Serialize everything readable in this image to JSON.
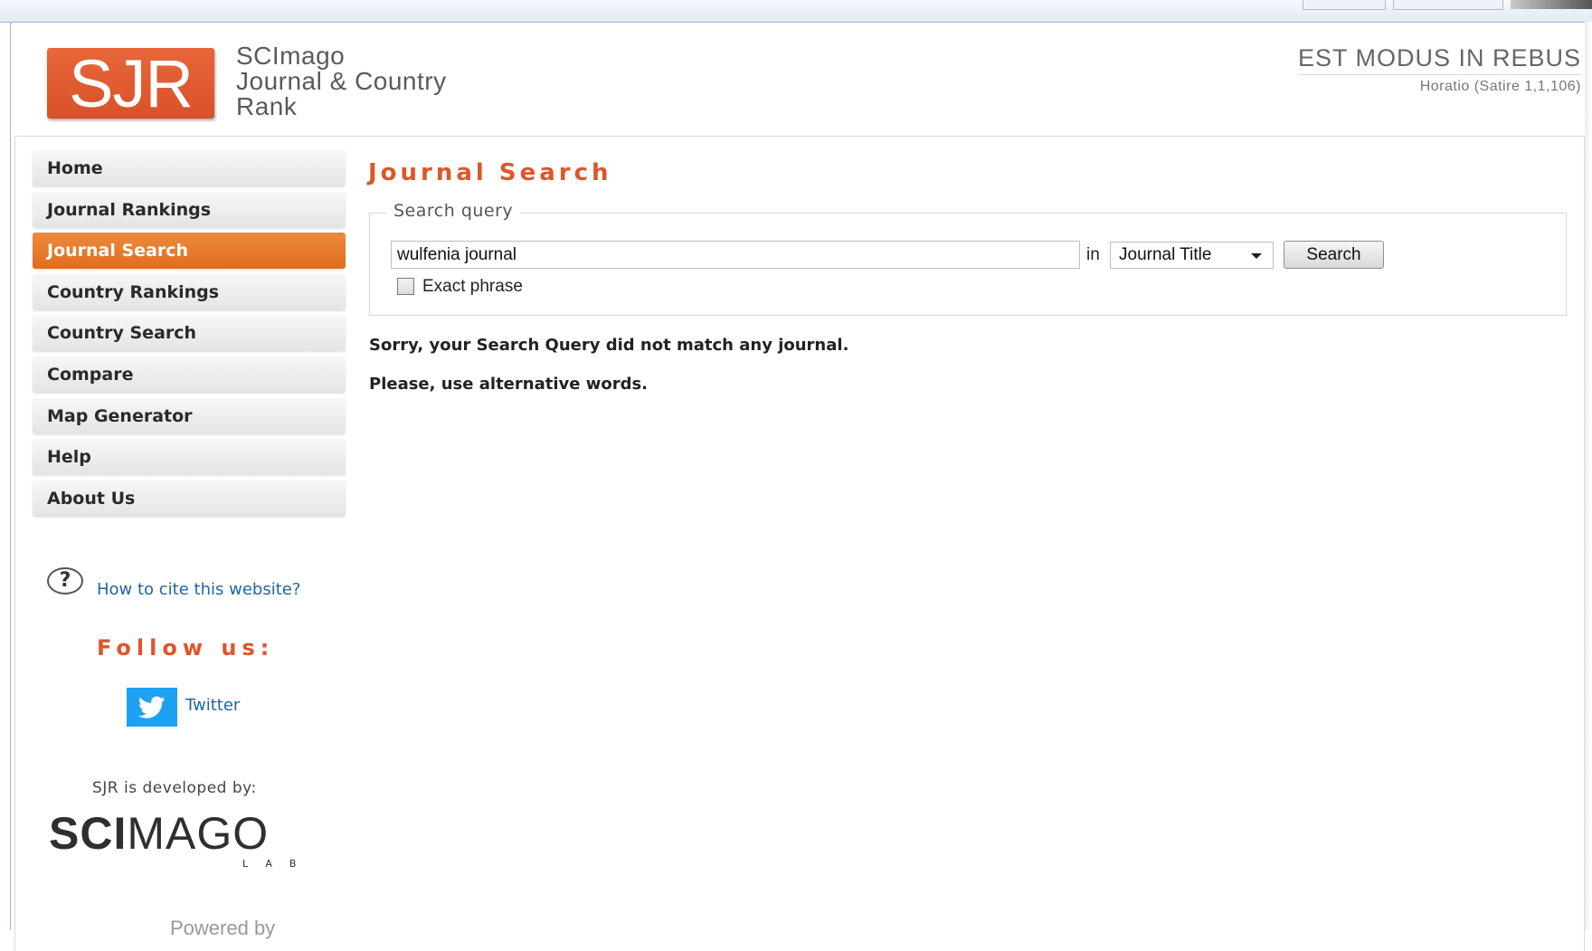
{
  "header": {
    "logo_text": "SJR",
    "site_title_lines": [
      "SCImago",
      "Journal & Country",
      "Rank"
    ],
    "motto": "EST MODUS IN REBUS",
    "motto_source": "Horatio (Satire 1,1,106)"
  },
  "sidebar": {
    "items": [
      {
        "label": "Home",
        "active": false
      },
      {
        "label": "Journal Rankings",
        "active": false
      },
      {
        "label": "Journal Search",
        "active": true
      },
      {
        "label": "Country Rankings",
        "active": false
      },
      {
        "label": "Country Search",
        "active": false
      },
      {
        "label": "Compare",
        "active": false
      },
      {
        "label": "Map Generator",
        "active": false
      },
      {
        "label": "Help",
        "active": false
      },
      {
        "label": "About Us",
        "active": false
      }
    ],
    "cite_icon": "question-circle-icon",
    "cite_link": "How to cite this website?",
    "follow_heading": "Follow us:",
    "twitter_icon": "twitter-icon",
    "twitter_label": "Twitter",
    "developed_by": "SJR is developed by:",
    "developer_logo": {
      "main_bold": "SCI",
      "main_light": "MAGO",
      "sub": "LAB"
    },
    "powered_by": "Powered by"
  },
  "main": {
    "title": "Journal Search",
    "fieldset_legend": "Search query",
    "search_value": "wulfenia journal",
    "in_label": "in",
    "search_field_selected": "Journal Title",
    "search_button": "Search",
    "exact_phrase_label": "Exact phrase",
    "exact_phrase_checked": false,
    "message_1": "Sorry, your Search Query did not match any journal.",
    "message_2": "Please, use alternative words."
  },
  "colors": {
    "brand_orange": "#e0552a",
    "active_nav": "#e8772a",
    "link_blue": "#1f66a3",
    "twitter_blue": "#1da1f2"
  }
}
